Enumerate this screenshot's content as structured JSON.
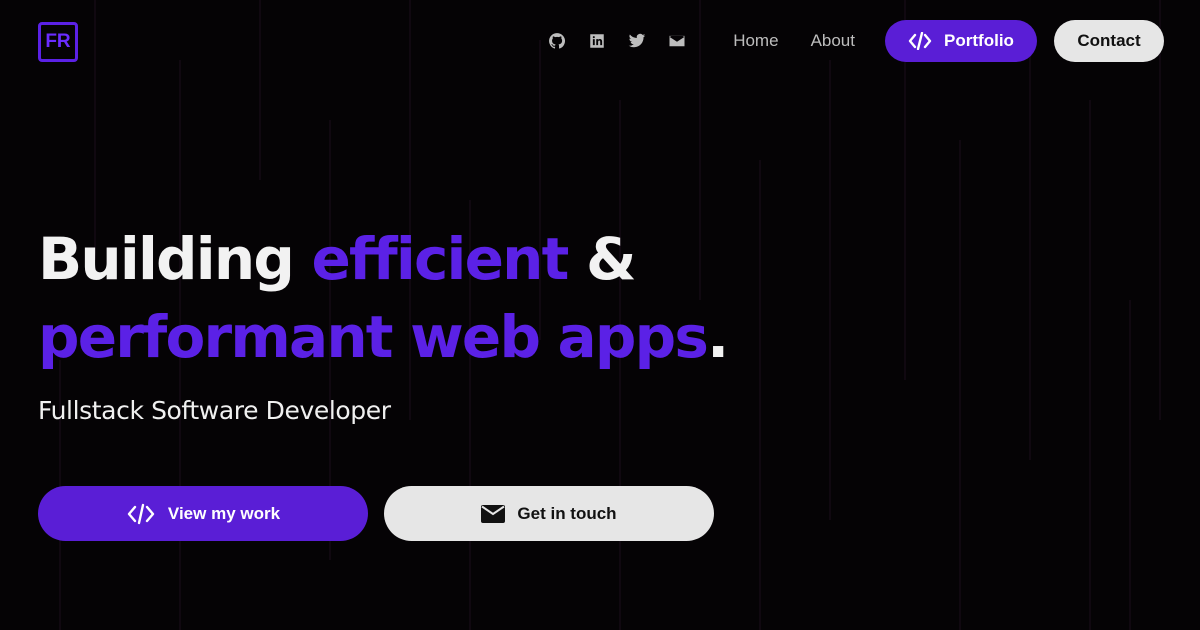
{
  "brand": {
    "logo_text": "FR",
    "accent_color": "#5b21e6"
  },
  "nav": {
    "social_icons": [
      "github-icon",
      "linkedin-icon",
      "twitter-icon",
      "mail-icon"
    ],
    "links": [
      "Home",
      "About"
    ],
    "portfolio_label": "Portfolio",
    "contact_label": "Contact"
  },
  "hero": {
    "line1_white": "Building ",
    "line1_accent": "efficient",
    "line1_white_end": " &",
    "line2_accent": "performant web apps",
    "line2_white_end": ".",
    "subtitle": "Fullstack Software Developer"
  },
  "cta": {
    "primary_label": "View my work",
    "primary_icon": "code-icon",
    "secondary_label": "Get in touch",
    "secondary_icon": "mail-icon"
  }
}
